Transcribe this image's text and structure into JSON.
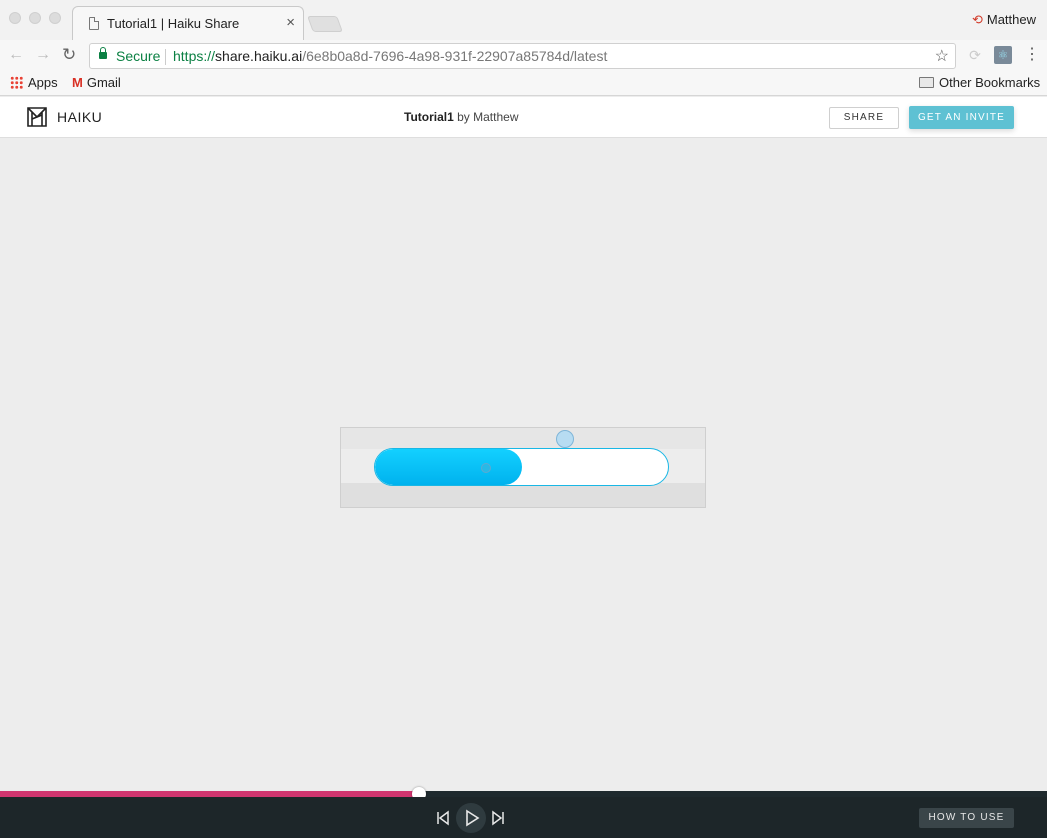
{
  "browser": {
    "tab_title": "Tutorial1 | Haiku Share",
    "tab_close": "×",
    "profile_name": "Matthew",
    "security_label": "Secure",
    "url": {
      "scheme": "https://",
      "host": "share.haiku.ai",
      "path": "/6e8b0a8d-7696-4a98-931f-22907a85784d/latest"
    },
    "bookmarks": [
      {
        "label": "Apps",
        "icon": "apps-grid-icon"
      },
      {
        "label": "Gmail",
        "icon": "gmail-icon"
      }
    ],
    "other_bookmarks": "Other Bookmarks"
  },
  "app": {
    "brand": "HAIKU",
    "project_name": "Tutorial1",
    "by_text": "by Matthew",
    "share_label": "SHARE",
    "invite_label": "GET AN INVITE"
  },
  "stage": {
    "slider_fill_fraction": 0.5
  },
  "player": {
    "progress_fraction": 0.4,
    "how_to_label": "HOW TO USE"
  },
  "colors": {
    "accent_cyan": "#00b2ee",
    "invite_button": "#5ec1d3",
    "progress_pink": "#d1356f",
    "player_bg": "#1d2629",
    "secure_green": "#0b8043"
  }
}
